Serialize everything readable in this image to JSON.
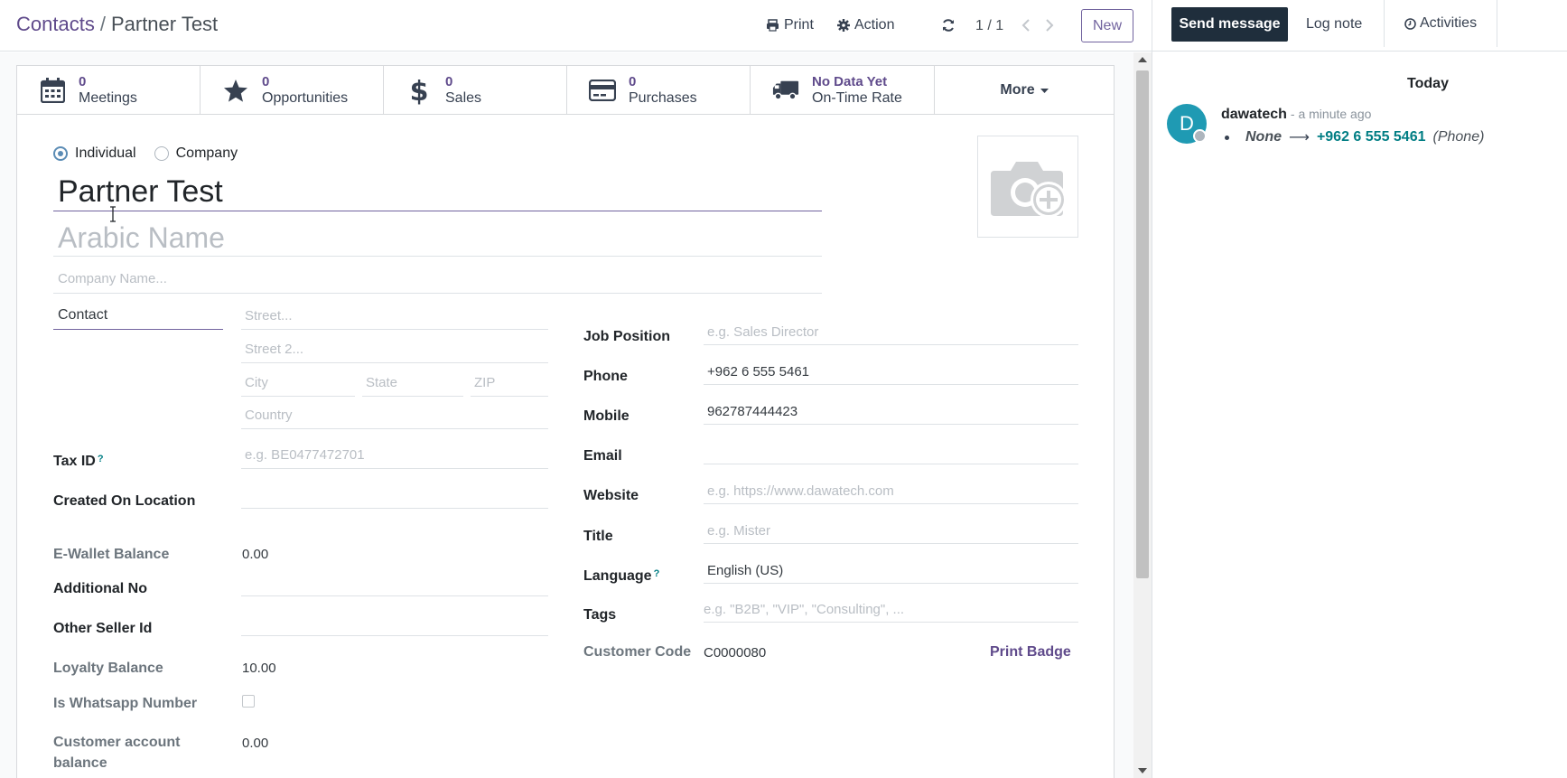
{
  "breadcrumb": {
    "parent": "Contacts",
    "separator": "/",
    "current": "Partner Test"
  },
  "control_panel": {
    "print_label": "Print",
    "action_label": "Action",
    "pager_value": "1 / 1",
    "new_label": "New"
  },
  "smart_buttons": [
    {
      "value": "0",
      "label": "Meetings",
      "icon": "calendar-icon"
    },
    {
      "value": "0",
      "label": "Opportunities",
      "icon": "star-icon"
    },
    {
      "value": "0",
      "label": "Sales",
      "icon": "dollar-icon"
    },
    {
      "value": "0",
      "label": "Purchases",
      "icon": "credit-card-icon"
    },
    {
      "value": "No Data Yet",
      "label": "On-Time Rate",
      "icon": "truck-icon"
    }
  ],
  "more_label": "More",
  "form": {
    "company_type": {
      "individual_label": "Individual",
      "company_label": "Company",
      "selected": "Individual"
    },
    "name_value": "Partner Test",
    "arabic_name_placeholder": "Arabic Name",
    "company_name_placeholder": "Company Name...",
    "address_type_value": "Contact",
    "street_placeholder": "Street...",
    "street2_placeholder": "Street 2...",
    "city_placeholder": "City",
    "state_placeholder": "State",
    "zip_placeholder": "ZIP",
    "country_placeholder": "Country",
    "left_fields": {
      "tax_id_label": "Tax ID",
      "tax_id_placeholder": "e.g. BE0477472701",
      "created_on_location_label": "Created On Location",
      "ewallet_label": "E-Wallet Balance",
      "ewallet_value": "0.00",
      "additional_no_label": "Additional No",
      "other_seller_label": "Other Seller Id",
      "loyalty_label": "Loyalty Balance",
      "loyalty_value": "10.00",
      "whatsapp_label": "Is Whatsapp Number",
      "customer_balance_label_1": "Customer account",
      "customer_balance_label_2": "balance",
      "customer_balance_value": "0.00"
    },
    "right_fields": {
      "job_position_label": "Job Position",
      "job_position_placeholder": "e.g. Sales Director",
      "phone_label": "Phone",
      "phone_value": "+962 6 555 5461",
      "mobile_label": "Mobile",
      "mobile_value": "962787444423",
      "email_label": "Email",
      "website_label": "Website",
      "website_placeholder": "e.g. https://www.dawatech.com",
      "title_label": "Title",
      "title_placeholder": "e.g. Mister",
      "language_label": "Language",
      "language_value": "English (US)",
      "tags_label": "Tags",
      "tags_placeholder": "e.g. \"B2B\", \"VIP\", \"Consulting\", ...",
      "customer_code_label": "Customer Code",
      "customer_code_value": "C0000080",
      "print_badge_label": "Print Badge"
    },
    "help_mark": "?"
  },
  "chatter": {
    "send_message_label": "Send message",
    "log_note_label": "Log note",
    "activities_label": "Activities",
    "today_label": "Today",
    "message": {
      "avatar_letter": "D",
      "author": "dawatech",
      "date": "- a minute ago",
      "old_value": "None",
      "arrow": "⟶",
      "new_value": "+962 6 555 5461",
      "field": "(Phone)"
    }
  },
  "colors": {
    "accent": "#71639e",
    "link_purple": "#5f4a8b",
    "teal": "#017e84",
    "send_button": "#1f2e3c",
    "avatar": "#1f9ab3"
  }
}
